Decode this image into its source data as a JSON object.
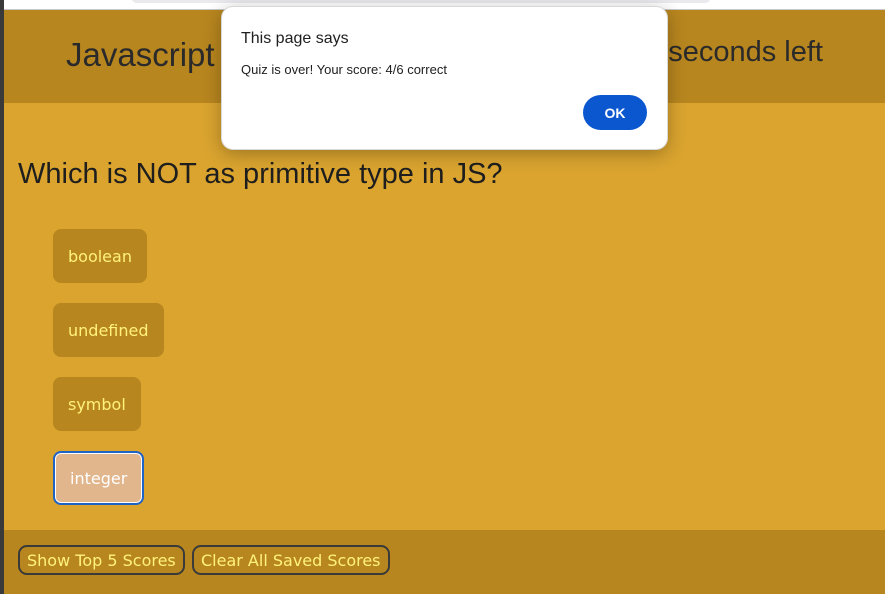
{
  "header": {
    "title": "Javascript Quiz",
    "timer": "seconds left"
  },
  "question": {
    "text": "Which is NOT as primitive type in JS?"
  },
  "answers": [
    {
      "label": "boolean"
    },
    {
      "label": "undefined"
    },
    {
      "label": "symbol"
    },
    {
      "label": "integer"
    }
  ],
  "footer": {
    "show_top5_label": "Show Top 5 Scores",
    "clear_scores_label": "Clear All Saved Scores"
  },
  "dialog": {
    "title": "This page says",
    "message": "Quiz is over! Your score: 4/6 correct",
    "ok_label": "OK"
  },
  "colors": {
    "page_background": "#daa42f",
    "header_background": "#b8861f",
    "answer_text": "#fff27a",
    "dialog_button": "#0b57d0"
  }
}
